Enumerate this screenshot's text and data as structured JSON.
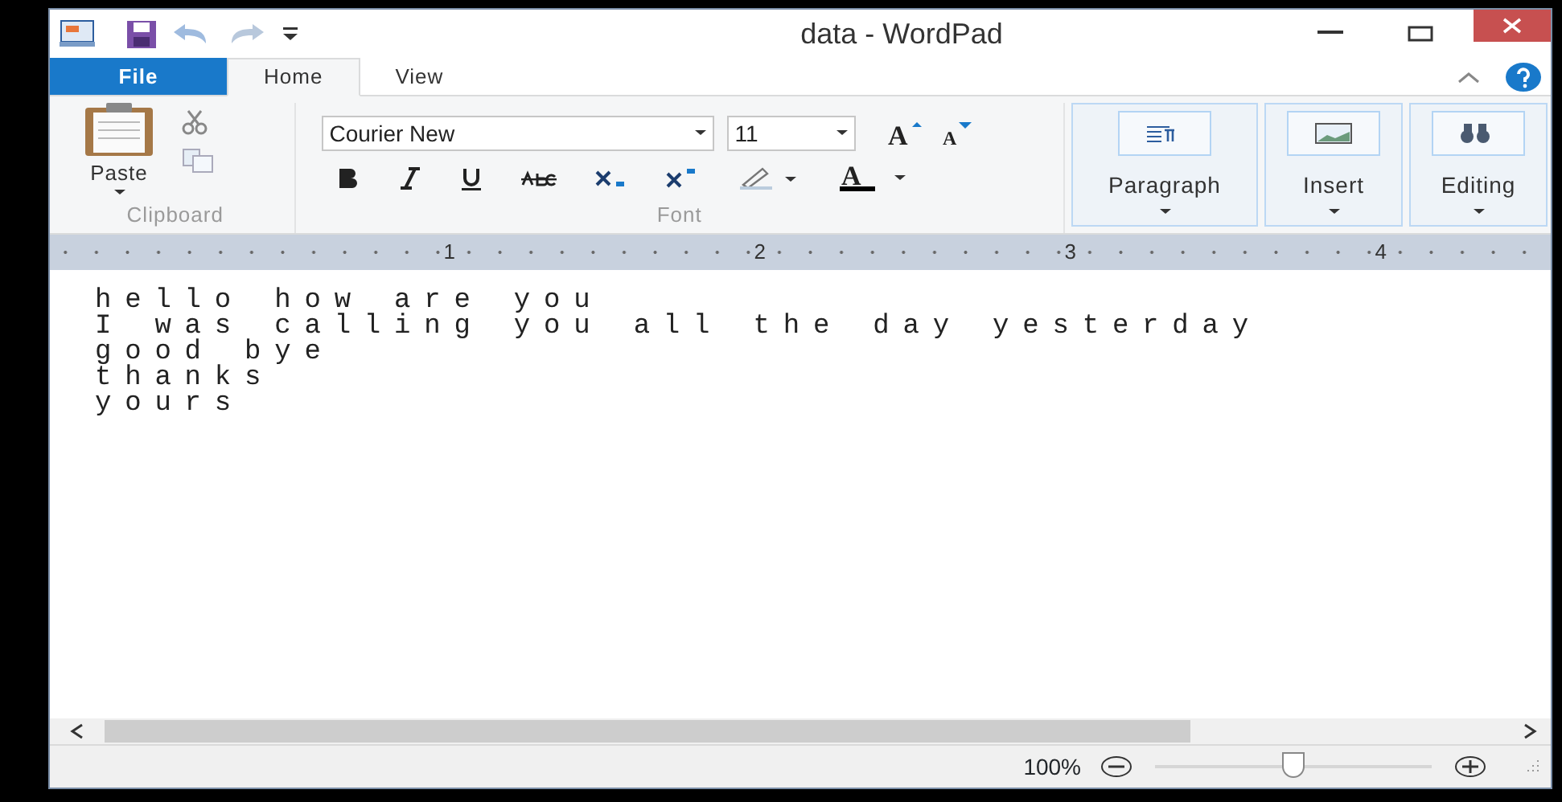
{
  "window": {
    "title": "data - WordPad"
  },
  "tabs": [
    {
      "label": "File",
      "kind": "file",
      "selected": false
    },
    {
      "label": "Home",
      "kind": "tab",
      "selected": true
    },
    {
      "label": "View",
      "kind": "tab",
      "selected": false
    }
  ],
  "ribbon": {
    "clipboard": {
      "label": "Clipboard",
      "paste": "Paste"
    },
    "font": {
      "label": "Font",
      "family": "Courier New",
      "size": "11",
      "grow_glyph": "A",
      "shrink_glyph": "A",
      "color_glyph": "A"
    },
    "groups": [
      {
        "label": "Paragraph",
        "kind": "paragraph"
      },
      {
        "label": "Insert",
        "kind": "insert"
      },
      {
        "label": "Editing",
        "kind": "editing"
      }
    ]
  },
  "ruler": {
    "numbers": [
      "1",
      "2",
      "3",
      "4"
    ]
  },
  "document": {
    "lines": [
      "hello how are you",
      "I was calling you all the day yesterday",
      "good bye",
      "thanks",
      "yours"
    ]
  },
  "status_bar": {
    "zoom": "100%",
    "zoom_slider": {
      "level": 0.5
    }
  }
}
